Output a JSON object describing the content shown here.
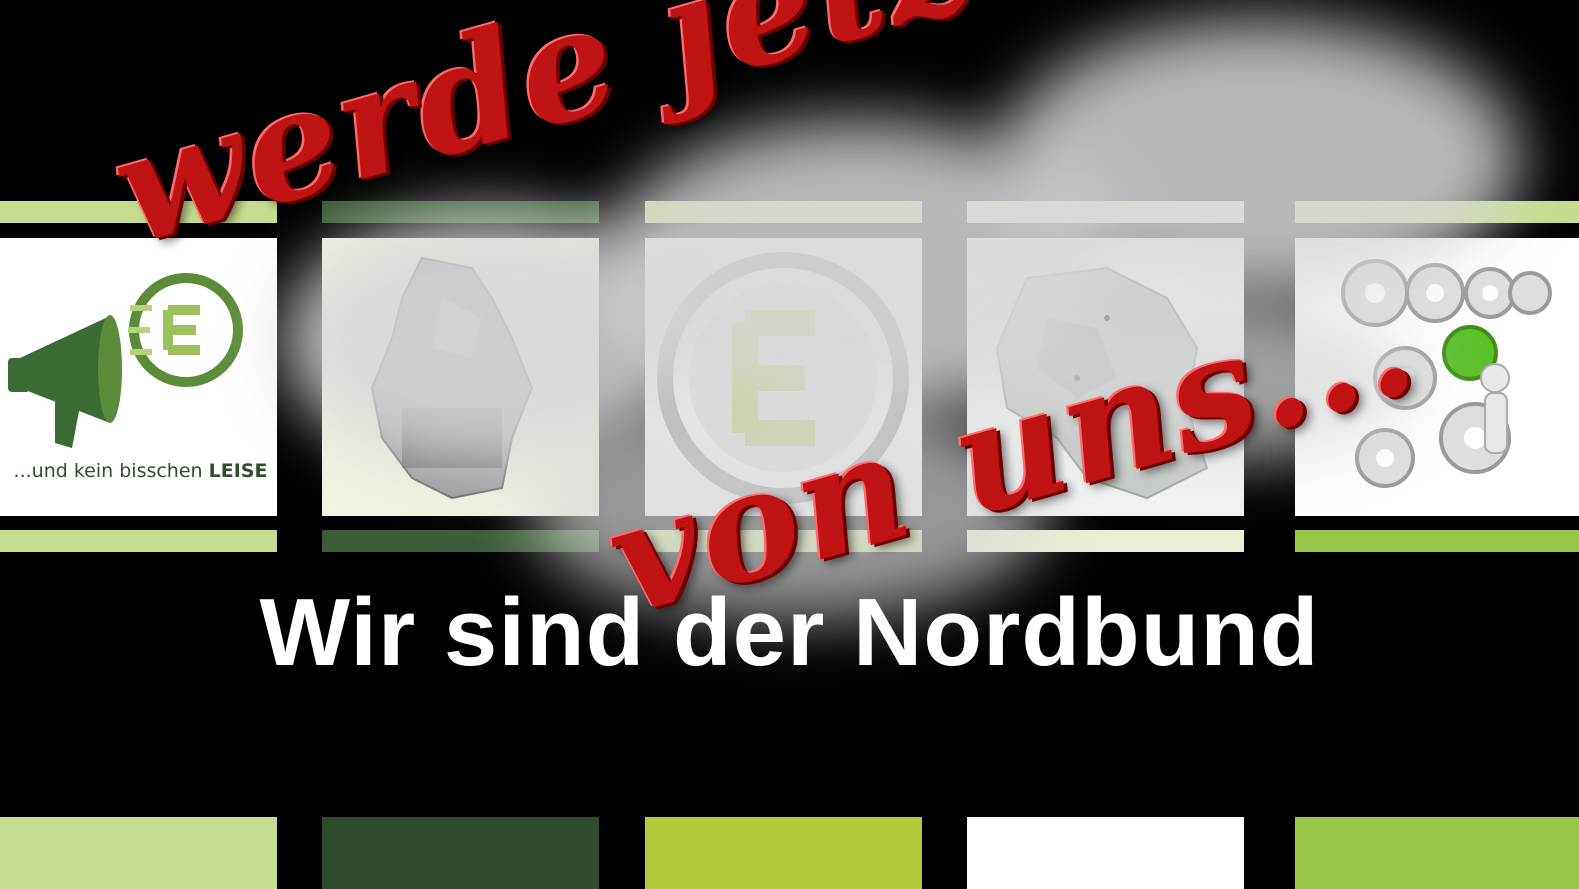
{
  "headline": {
    "line1": "werde jetzt Teil",
    "line2": "von uns..."
  },
  "tagline": "Wir sind der Nordbund",
  "panel1": {
    "caption_prefix": "...und kein bisschen ",
    "caption_strong": "LEISE"
  },
  "colors": {
    "headline_red": "#c01414",
    "light_green": "#c6dc8e",
    "dark_green": "#2f4a2c",
    "lime_green": "#b1c93a",
    "white": "#ffffff",
    "bright_green": "#98c648"
  },
  "icons": [
    "megaphone-icon",
    "euro-circle-icon",
    "germany-map",
    "region-map",
    "gears-icon"
  ]
}
